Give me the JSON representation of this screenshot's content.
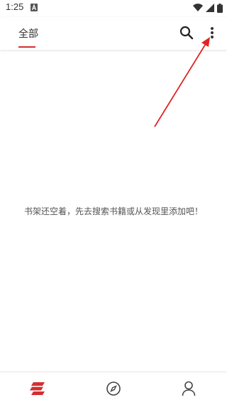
{
  "status_bar": {
    "time": "1:25",
    "icons": [
      "notification-a-icon",
      "wifi-icon",
      "signal-icon",
      "battery-icon"
    ]
  },
  "app_bar": {
    "tab_label": "全部",
    "accent_color": "#d32f2f",
    "actions": [
      "search-icon",
      "more-vert-icon"
    ]
  },
  "empty_state": {
    "message": "书架还空着，先去搜索书籍或从发现里添加吧！"
  },
  "bottom_nav": {
    "items": [
      {
        "icon": "bookshelf-icon",
        "active": true
      },
      {
        "icon": "compass-icon",
        "active": false
      },
      {
        "icon": "person-icon",
        "active": false
      }
    ]
  }
}
